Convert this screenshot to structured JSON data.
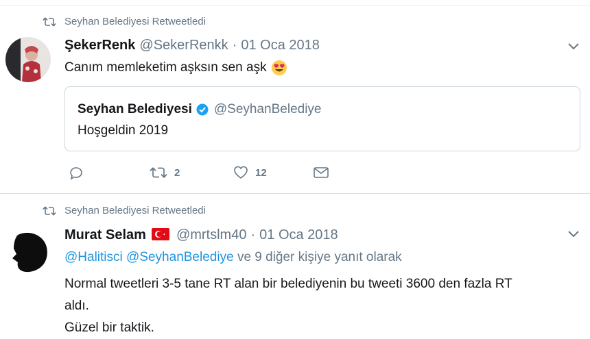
{
  "tweets": [
    {
      "retweeted_by": "Seyhan Belediyesi Retweetledi",
      "name": "ŞekerRenk",
      "handle": "@SekerRenkk",
      "date": "01 Oca 2018",
      "text": "Canım memleketim aşksın sen aşk",
      "emoji_icon": "heart-eyes-emoji",
      "quote": {
        "name": "Seyhan Belediyesi",
        "handle": "@SeyhanBelediye",
        "text": "Hoşgeldin 2019"
      },
      "actions": {
        "retweets": "2",
        "likes": "12"
      }
    },
    {
      "retweeted_by": "Seyhan Belediyesi Retweetledi",
      "name": "Murat Selam",
      "flag_icon": "turkey-flag-icon",
      "handle": "@mrtslm40",
      "date": "01 Oca 2018",
      "reply_mentions": [
        "@Halitisci",
        "@SeyhanBelediye"
      ],
      "reply_suffix": "ve 9 diğer kişiye yanıt olarak",
      "lines": [
        "Normal tweetleri 3-5 tane RT alan bir belediyenin bu tweeti 3600 den fazla RT",
        "aldı.",
        "Güzel bir taktik."
      ]
    }
  ],
  "colors": {
    "accent": "#1b95e0",
    "muted": "#657786",
    "text": "#14171a",
    "border": "#ccd6dd",
    "flag_red": "#e30a17"
  },
  "dot": "·"
}
